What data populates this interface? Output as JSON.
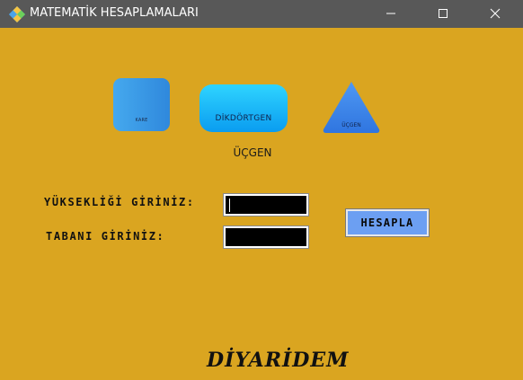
{
  "window": {
    "title": "MATEMATİK HESAPLAMALARI",
    "icon": "app-diamond-icon",
    "controls": [
      "minimize-icon",
      "maximize-icon",
      "close-icon"
    ]
  },
  "shape_buttons": [
    {
      "label": "KARE",
      "shape": "rounded-square",
      "color": "#3A9BE8"
    },
    {
      "label": "DİKDÖRTGEN",
      "shape": "rounded-rectangle",
      "color": "#14B4F8"
    },
    {
      "label": "ÜÇGEN",
      "shape": "triangle",
      "color": "#3D86EC"
    }
  ],
  "mode": {
    "label": "ÜÇGEN"
  },
  "form": {
    "height_label": "YÜKSEKLİĞİ GİRİNİZ:",
    "height_value": "",
    "base_label": "TABANI GİRİNİZ:",
    "base_value": "",
    "calculate_label": "HESAPLA"
  },
  "brand": "DİYARİDEM",
  "colors": {
    "background": "#DAA520",
    "titlebar": "#585858",
    "input_bg": "#000000",
    "button": "#6C9FF2"
  }
}
